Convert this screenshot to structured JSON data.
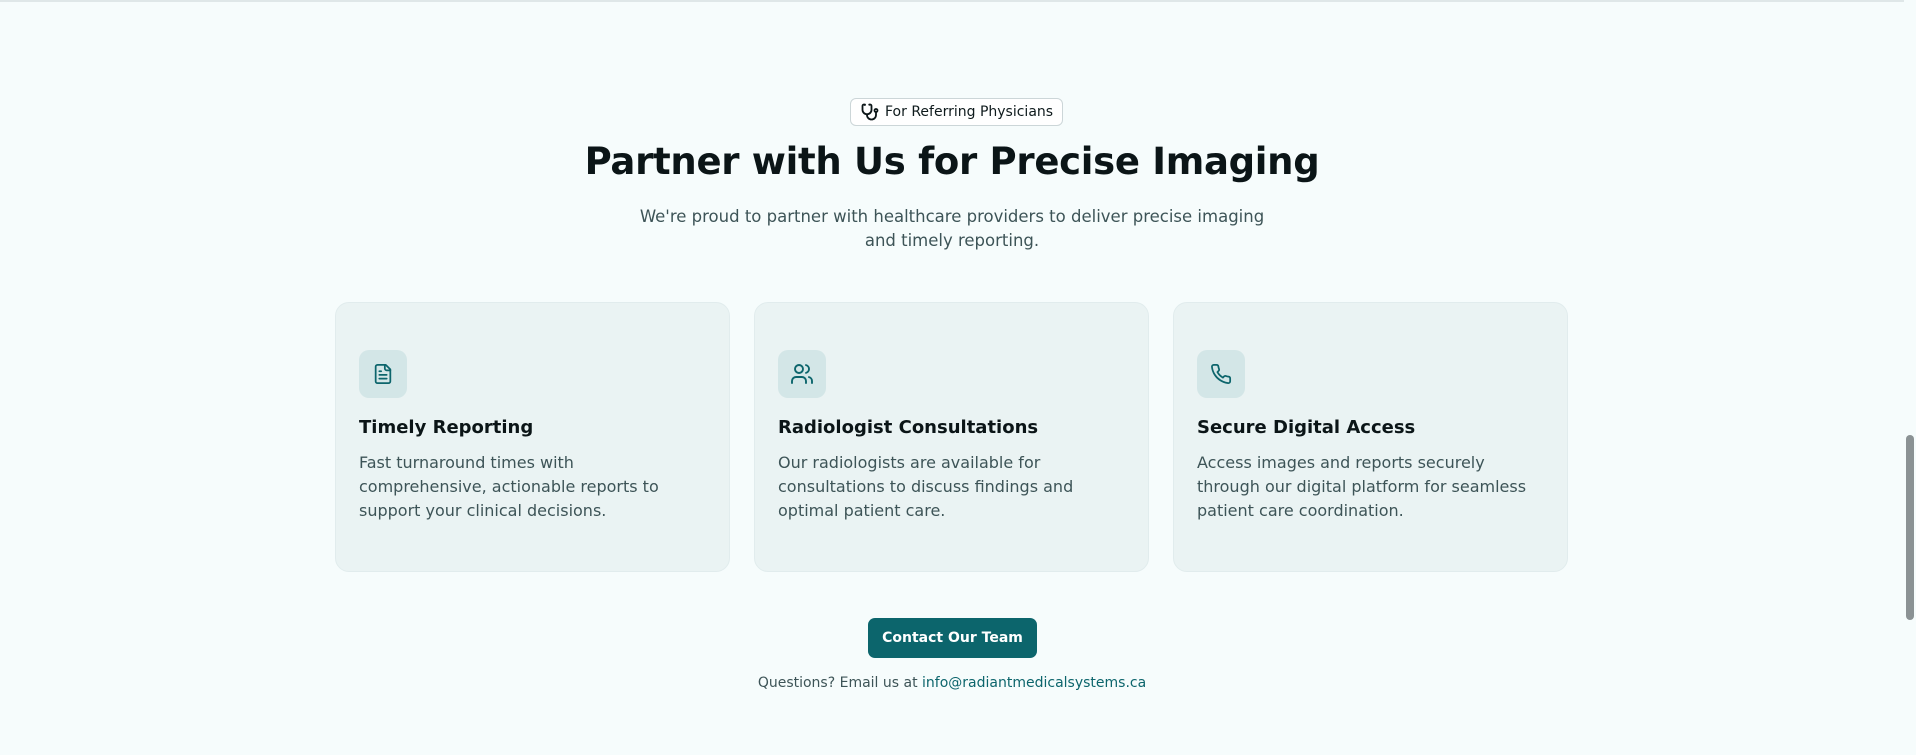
{
  "badge": {
    "icon": "stethoscope-icon",
    "label": "For Referring Physicians"
  },
  "heading": "Partner with Us for Precise Imaging",
  "subheading": "We're proud to partner with healthcare providers to deliver precise imaging and timely reporting.",
  "cards": [
    {
      "icon": "file-text-icon",
      "title": "Timely Reporting",
      "text": "Fast turnaround times with comprehensive, actionable reports to support your clinical decisions."
    },
    {
      "icon": "users-icon",
      "title": "Radiologist Consultations",
      "text": "Our radiologists are available for consultations to discuss findings and optimal patient care."
    },
    {
      "icon": "phone-icon",
      "title": "Secure Digital Access",
      "text": "Access images and reports securely through our digital platform for seamless patient care coordination."
    }
  ],
  "cta": {
    "label": "Contact Our Team"
  },
  "contact": {
    "prefix": "Questions? Email us at",
    "email": "info@radiantmedicalsystems.ca"
  },
  "colors": {
    "accent": "#0c656c",
    "background": "#f6fcfc",
    "card_background": "#eaf3f3",
    "icon_background": "#d3e6e7"
  }
}
